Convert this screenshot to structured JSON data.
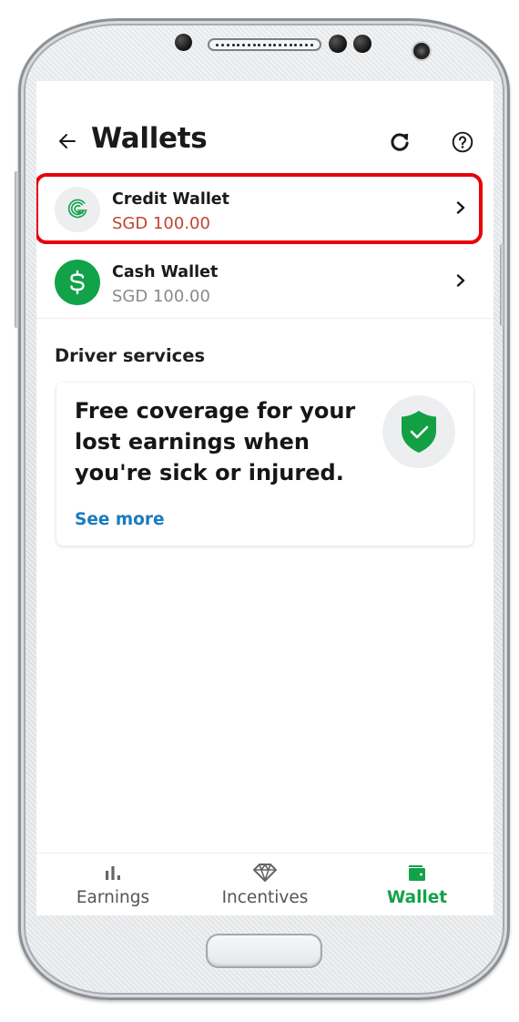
{
  "device": {
    "hardware": [
      "proximity-sensor",
      "earpiece-speaker",
      "sensor",
      "sensor",
      "front-camera",
      "home-button",
      "volume-button",
      "power-button"
    ]
  },
  "header": {
    "title": "Wallets",
    "back_icon": "arrow-left-icon",
    "refresh_icon": "refresh-icon",
    "help_icon": "help-circle-icon"
  },
  "wallets": [
    {
      "name": "Credit Wallet",
      "amount": "SGD 100.00",
      "icon": "grab-g-logo-icon",
      "amount_color": "#c0452f",
      "highlighted": true
    },
    {
      "name": "Cash Wallet",
      "amount": "SGD 100.00",
      "icon": "dollar-icon",
      "amount_color": "#8a8a8a",
      "highlighted": false
    }
  ],
  "driver_services": {
    "section_title": "Driver services",
    "card": {
      "text": "Free coverage for your lost earnings when you're sick or injured.",
      "link_label": "See more",
      "icon": "shield-check-icon"
    }
  },
  "bottom_nav": {
    "items": [
      {
        "label": "Earnings",
        "icon": "bar-chart-icon",
        "active": false
      },
      {
        "label": "Incentives",
        "icon": "diamond-icon",
        "active": false
      },
      {
        "label": "Wallet",
        "icon": "wallet-icon",
        "active": true
      }
    ]
  },
  "colors": {
    "brand_green": "#12a24a",
    "highlight_red": "#e8000b",
    "link_blue": "#1a7bbf",
    "credit_amount": "#c0452f",
    "muted_text": "#8a8a8a"
  }
}
